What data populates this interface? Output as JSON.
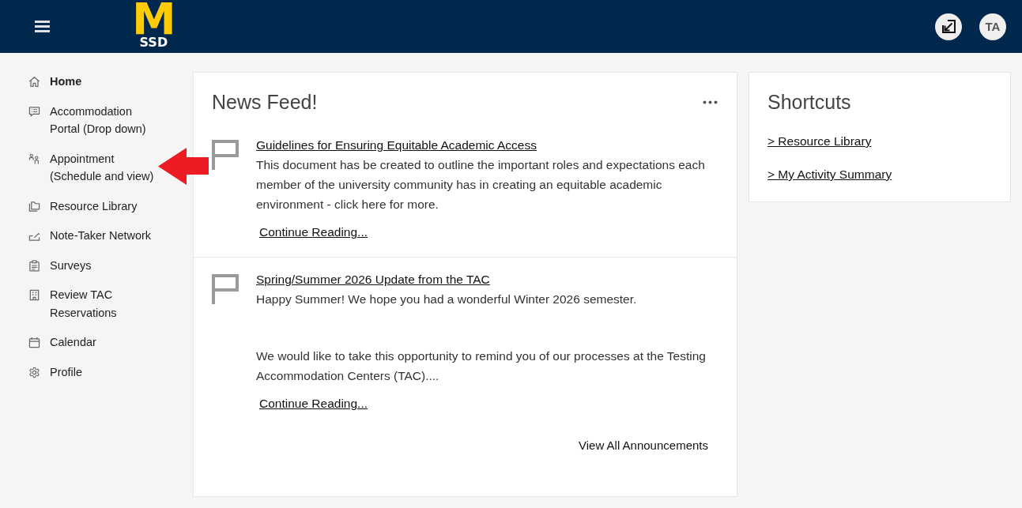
{
  "header": {
    "logo": {
      "mark": "M",
      "subtitle": "SSD"
    },
    "avatar": {
      "initials": "TA"
    }
  },
  "sidebar": {
    "items": [
      {
        "label": "Home",
        "selected": true
      },
      {
        "label": "Accommodation Portal (Drop down)",
        "selected": false
      },
      {
        "label": "Appointment (Schedule and view)",
        "selected": false
      },
      {
        "label": "Resource Library",
        "selected": false
      },
      {
        "label": "Note-Taker Network",
        "selected": false
      },
      {
        "label": "Surveys",
        "selected": false
      },
      {
        "label": "Review TAC Reservations",
        "selected": false
      },
      {
        "label": "Calendar",
        "selected": false
      },
      {
        "label": "Profile",
        "selected": false
      }
    ]
  },
  "news_feed": {
    "title": "News Feed!",
    "items": [
      {
        "title": "Guidelines for Ensuring Equitable Academic Access",
        "paragraphs": [
          "This document has be created to outline the important roles and expectations each member of the university community has in creating an equitable academic environment - click here for more."
        ],
        "link": "Continue Reading..."
      },
      {
        "title": "Spring/Summer 2026 Update from the TAC",
        "paragraphs": [
          "Happy Summer! We hope you had a wonderful Winter 2026 semester.",
          "We would like to take this opportunity to remind you of our processes at the Testing Accommodation Centers (TAC)...."
        ],
        "link": "Continue Reading..."
      }
    ],
    "footer_link": "View All Announcements"
  },
  "shortcuts": {
    "title": "Shortcuts",
    "links": [
      "> Resource Library",
      "> My Activity Summary"
    ]
  }
}
